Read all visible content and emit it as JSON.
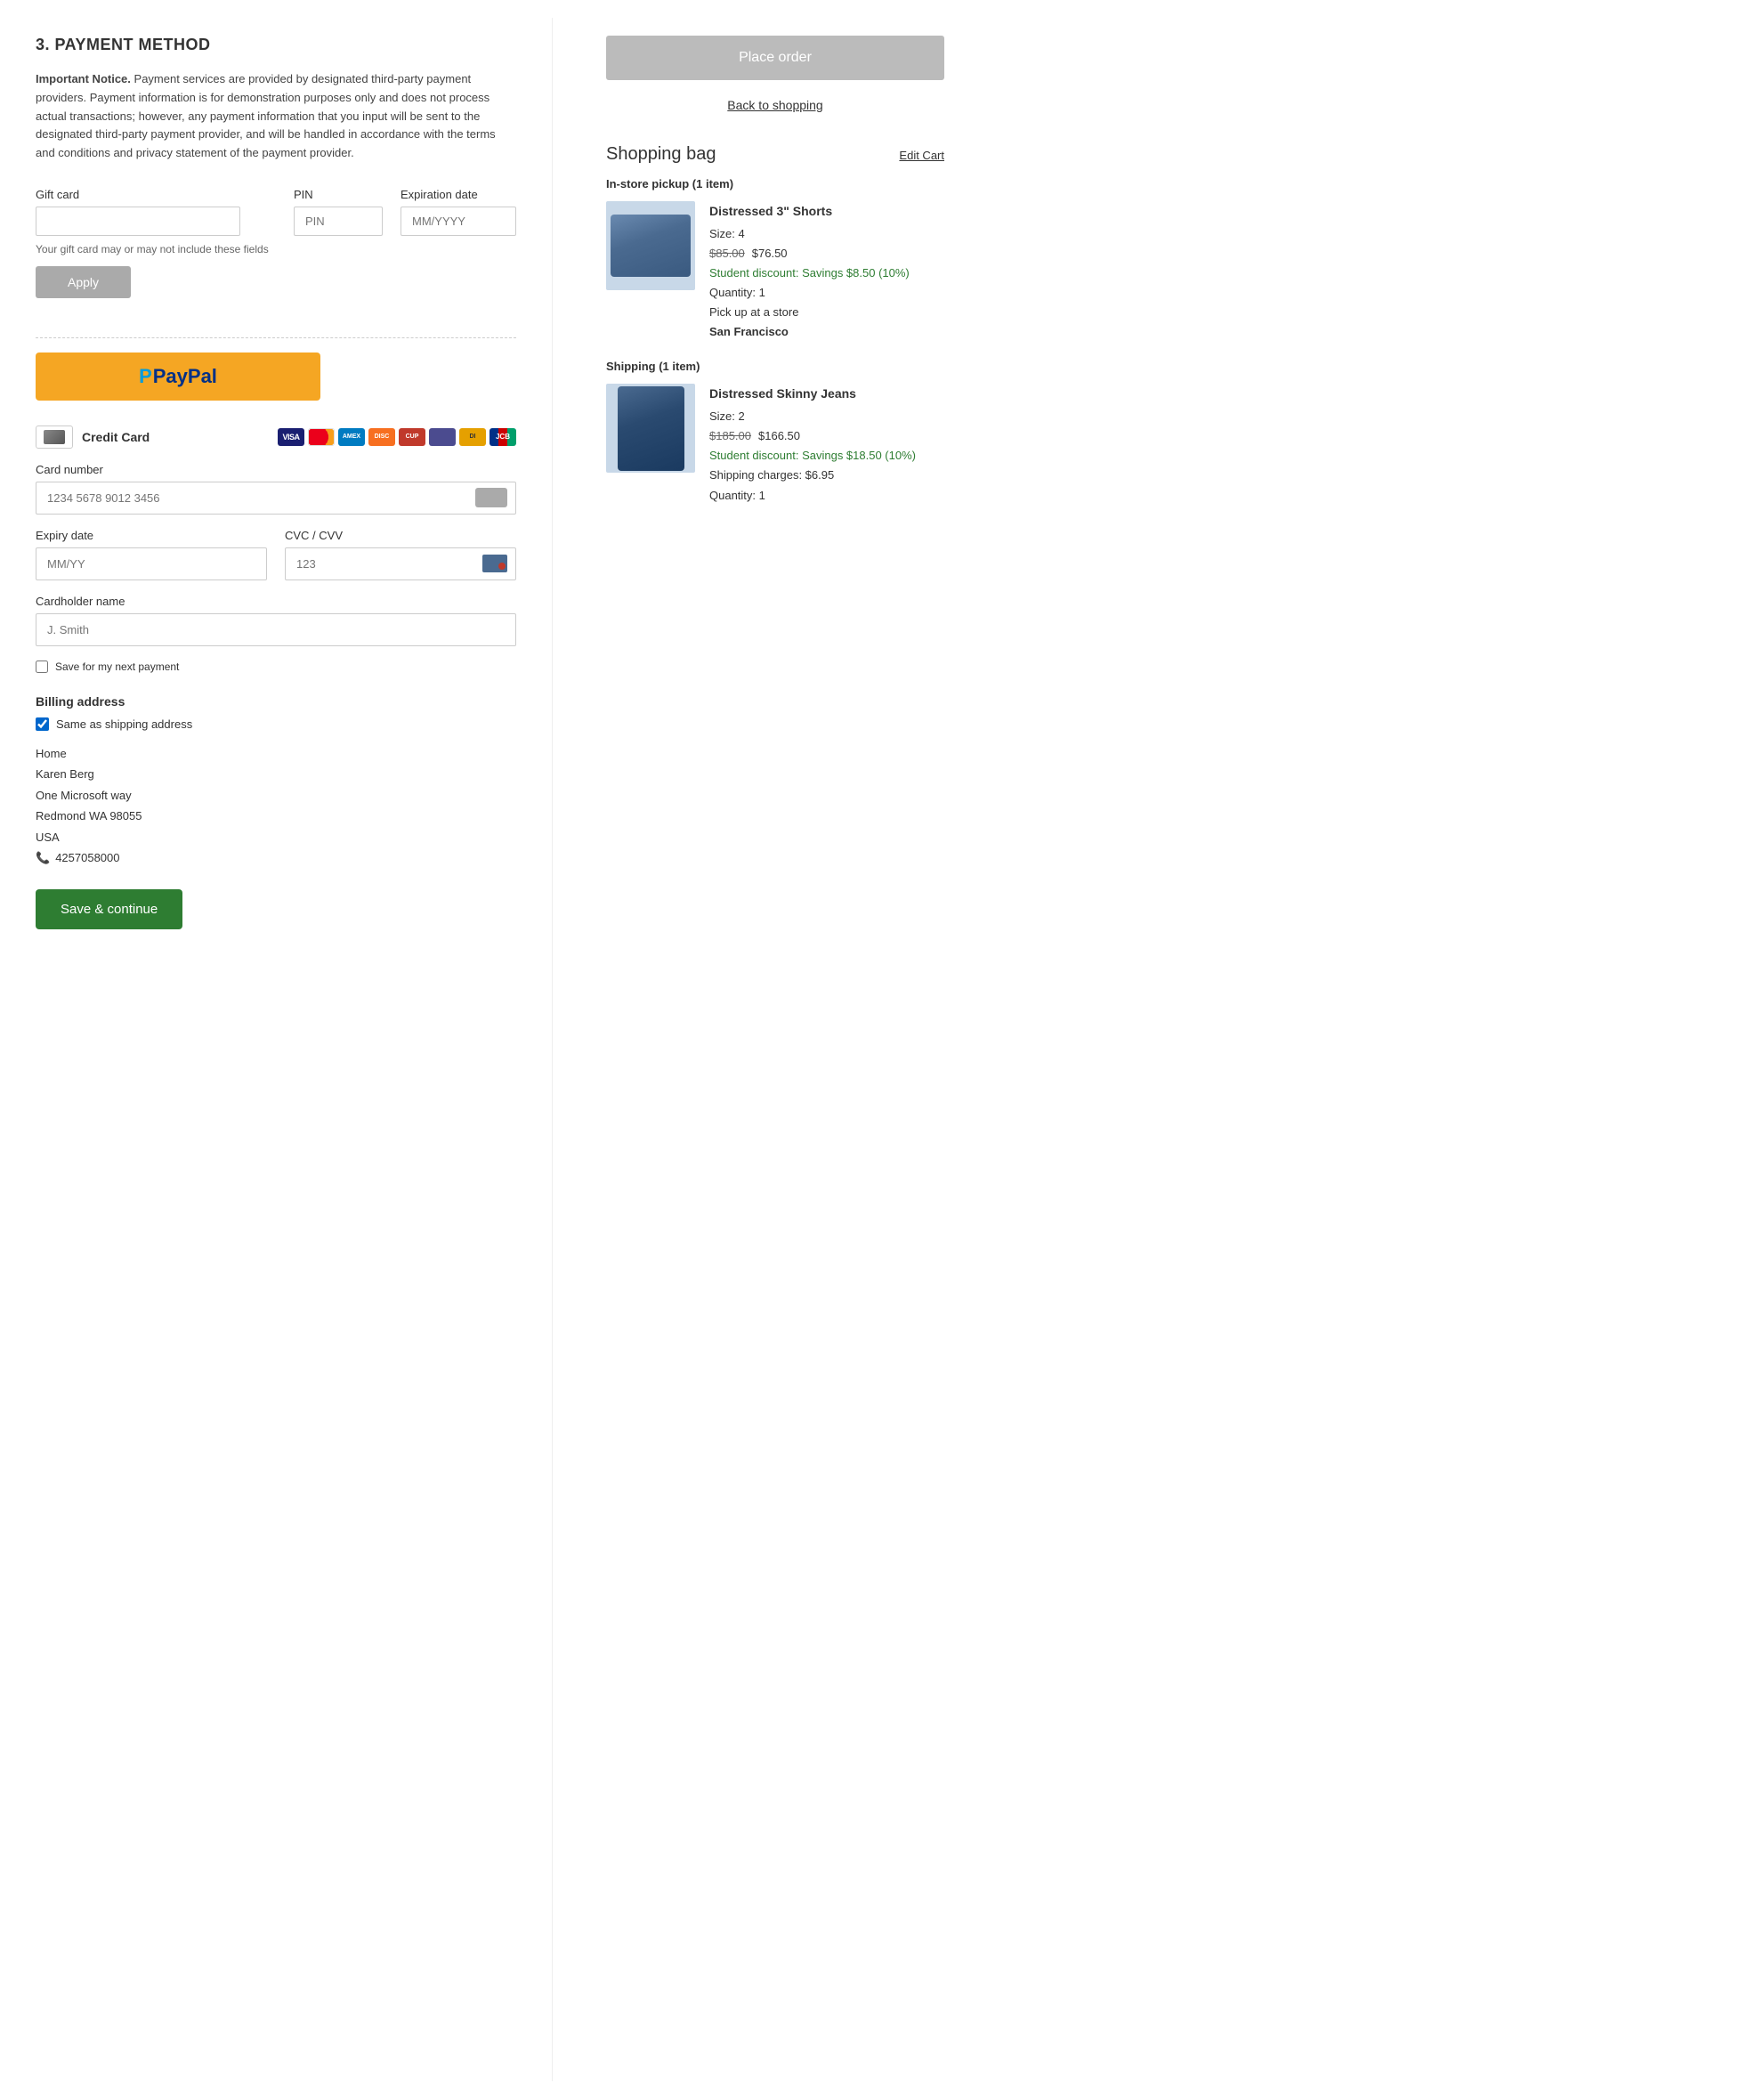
{
  "left": {
    "section_title": "3. PAYMENT METHOD",
    "notice": {
      "bold": "Important Notice.",
      "text": "  Payment services are provided by designated third-party payment providers.  Payment information is for demonstration purposes only and does not process actual transactions; however, any payment information that you input will be sent to the designated third-party payment provider, and will be handled in accordance with the terms and conditions and privacy statement of the payment provider."
    },
    "gift_card": {
      "label": "Gift card",
      "pin_label": "PIN",
      "pin_placeholder": "PIN",
      "expiry_label": "Expiration date",
      "expiry_placeholder": "MM/YYYY",
      "note": "Your gift card may or may not include these fields",
      "apply_label": "Apply"
    },
    "paypal": {
      "label": "PayPal"
    },
    "credit_card": {
      "label": "Credit Card",
      "card_number_label": "Card number",
      "card_number_placeholder": "1234 5678 9012 3456",
      "expiry_label": "Expiry date",
      "expiry_placeholder": "MM/YY",
      "cvc_label": "CVC / CVV",
      "cvc_placeholder": "123",
      "holder_label": "Cardholder name",
      "holder_placeholder": "J. Smith",
      "save_label": "Save for my next payment"
    },
    "billing": {
      "title": "Billing address",
      "same_label": "Same as shipping address",
      "address": {
        "line1": "Home",
        "line2": "Karen Berg",
        "line3": "One Microsoft way",
        "line4": "Redmond WA  98055",
        "line5": "USA",
        "phone": "4257058000"
      }
    },
    "save_continue_label": "Save & continue"
  },
  "right": {
    "place_order_label": "Place order",
    "back_to_shopping_label": "Back to shopping",
    "shopping_bag_title": "Shopping bag",
    "edit_cart_label": "Edit Cart",
    "instore_group_label": "In-store pickup (1 item)",
    "shipping_group_label": "Shipping (1 item)",
    "items": [
      {
        "name": "Distressed 3\" Shorts",
        "size_label": "Size:",
        "size": "4",
        "price_original": "$85.00",
        "price_new": "$76.50",
        "discount": "Student discount: Savings $8.50 (10%)",
        "quantity_label": "Quantity:",
        "quantity": "1",
        "pickup_label": "Pick up at a store",
        "pickup_store": "San Francisco",
        "type": "instore"
      },
      {
        "name": "Distressed Skinny Jeans",
        "size_label": "Size:",
        "size": "2",
        "price_original": "$185.00",
        "price_new": "$166.50",
        "discount": "Student discount: Savings $18.50 (10%)",
        "shipping_charges": "Shipping charges: $6.95",
        "quantity_label": "Quantity:",
        "quantity": "1",
        "type": "shipping"
      }
    ]
  }
}
